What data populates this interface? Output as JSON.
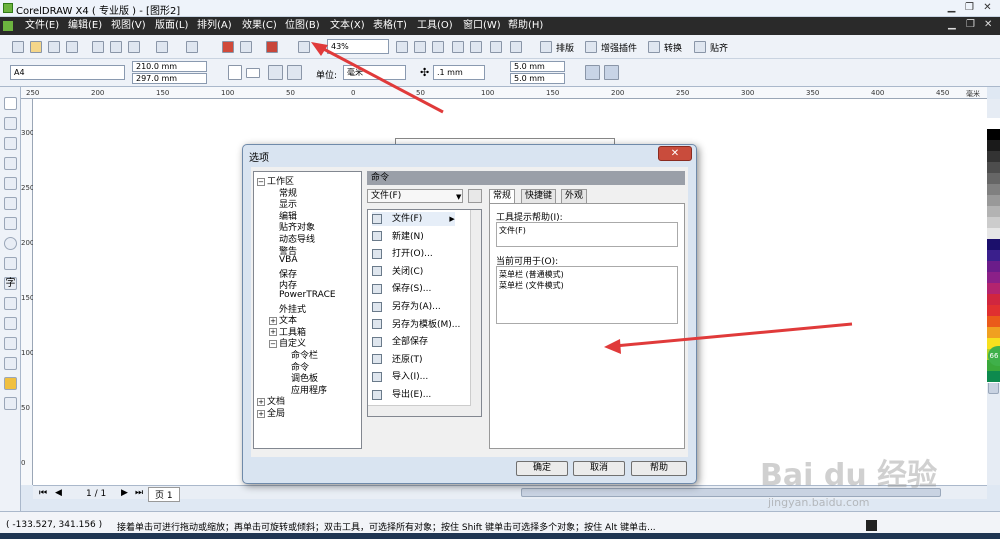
{
  "window": {
    "title": "CorelDRAW X4 ( 专业版 ) - [图形2]"
  },
  "menu": [
    "文件(E)",
    "编辑(E)",
    "视图(V)",
    "版面(L)",
    "排列(A)",
    "效果(C)",
    "位图(B)",
    "文本(X)",
    "表格(T)",
    "工具(O)",
    "窗口(W)",
    "帮助(H)"
  ],
  "toolbar1": {
    "zoom": "43%",
    "labels": [
      "排版",
      "增强插件",
      "转换",
      "贴齐"
    ]
  },
  "toolbar2": {
    "paper": "A4",
    "width": "210.0 mm",
    "height": "297.0 mm",
    "units_label": "单位:",
    "units": "毫米",
    "nudge": ".1 mm",
    "dup_x": "5.0 mm",
    "dup_y": "5.0 mm"
  },
  "ruler": {
    "unit": "毫米",
    "h_ticks": [
      "250",
      "200",
      "150",
      "100",
      "50",
      "0",
      "50",
      "100",
      "150",
      "200",
      "250",
      "300",
      "350",
      "400",
      "450"
    ],
    "v_ticks": [
      "300",
      "250",
      "200",
      "150",
      "100",
      "50",
      "0"
    ]
  },
  "page_nav": {
    "current": "1 / 1",
    "tab": "页 1"
  },
  "status": {
    "coords": "( -133.527, 341.156 )",
    "hint": "接着单击可进行拖动或缩放；再单击可旋转或倾斜；双击工具，可选择所有对象；按住 Shift 键单击可选择多个对象；按住 Alt 键单击..."
  },
  "dialog": {
    "title": "选项",
    "tree": [
      {
        "label": "工作区",
        "expander": "⊟",
        "level": 0
      },
      {
        "label": "常规",
        "level": 1
      },
      {
        "label": "显示",
        "level": 1
      },
      {
        "label": "编辑",
        "level": 1
      },
      {
        "label": "贴齐对象",
        "level": 1
      },
      {
        "label": "动态导线",
        "level": 1
      },
      {
        "label": "警告",
        "level": 1
      },
      {
        "label": "VBA",
        "level": 1
      },
      {
        "label": "保存",
        "level": 1
      },
      {
        "label": "内存",
        "level": 1
      },
      {
        "label": "PowerTRACE",
        "level": 1
      },
      {
        "label": "外挂式",
        "level": 1
      },
      {
        "label": "文本",
        "expander": "⊞",
        "level": 1
      },
      {
        "label": "工具箱",
        "expander": "⊞",
        "level": 1
      },
      {
        "label": "自定义",
        "expander": "⊟",
        "level": 1
      },
      {
        "label": "命令栏",
        "level": 2
      },
      {
        "label": "命令",
        "level": 2
      },
      {
        "label": "调色板",
        "level": 2
      },
      {
        "label": "应用程序",
        "level": 2
      },
      {
        "label": "文档",
        "expander": "⊞",
        "level": 0
      },
      {
        "label": "全局",
        "expander": "⊞",
        "level": 0
      }
    ],
    "section_title": "命令",
    "category": "文件(F)",
    "commands": [
      "文件(F)",
      "新建(N)",
      "打开(O)...",
      "关闭(C)",
      "保存(S)...",
      "另存为(A)...",
      "另存为模板(M)...",
      "全部保存",
      "还原(T)",
      "导入(I)...",
      "导出(E)..."
    ],
    "tabs": [
      "常规",
      "快捷键",
      "外观"
    ],
    "tooltip_label": "工具提示帮助(I):",
    "tooltip_value": "文件(F)",
    "available_label": "当前可用于(O):",
    "available_values": [
      "菜单栏 (普通模式)",
      "菜单栏 (文件模式)"
    ],
    "buttons": {
      "ok": "确定",
      "cancel": "取消",
      "help": "帮助"
    }
  },
  "watermark": {
    "brand": "Bai du 经验",
    "url": "jingyan.baidu.com"
  },
  "colors": {
    "arrow": "#e03a3a",
    "menubar": "#2a2a2a",
    "dialog_bg": "#d9e4f1"
  },
  "palette": [
    "#ffffff",
    "#000000",
    "#1a1a1a",
    "#333333",
    "#4d4d4d",
    "#666666",
    "#808080",
    "#999999",
    "#b3b3b3",
    "#cccccc",
    "#e6e6e6",
    "#1b0f6b",
    "#3a1f8c",
    "#6b1c8a",
    "#8b2088",
    "#b3246f",
    "#d0263f",
    "#e03030",
    "#ea5b1a",
    "#f0a020",
    "#f7e01e",
    "#b5d32a",
    "#3aa83b",
    "#0d8a4e"
  ]
}
